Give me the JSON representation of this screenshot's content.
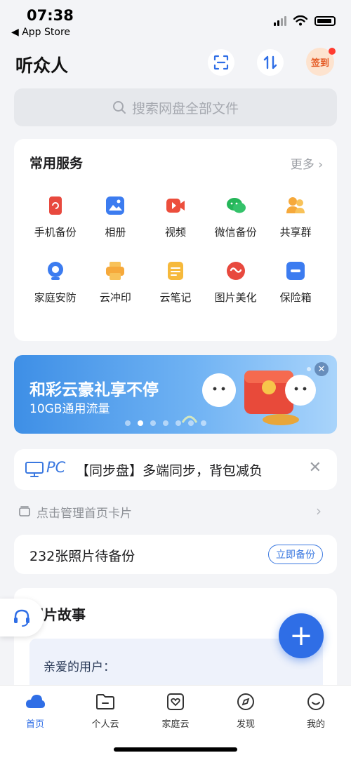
{
  "status_bar": {
    "time": "07:38",
    "back_label": "◀ App Store"
  },
  "header": {
    "username": "听众人",
    "checkin_label": "签到"
  },
  "search": {
    "placeholder": "搜索网盘全部文件"
  },
  "services": {
    "title": "常用服务",
    "more": "更多",
    "items": [
      {
        "label": "手机备份",
        "icon": "phone-backup-icon",
        "color": "#e8493e"
      },
      {
        "label": "相册",
        "icon": "album-icon",
        "color": "#3c7cf0"
      },
      {
        "label": "视频",
        "icon": "video-icon",
        "color": "#ec4e3c"
      },
      {
        "label": "微信备份",
        "icon": "wechat-icon",
        "color": "#25b659"
      },
      {
        "label": "共享群",
        "icon": "share-group-icon",
        "color": "#f6a93b"
      },
      {
        "label": "家庭安防",
        "icon": "camera-icon",
        "color": "#3c7cf0"
      },
      {
        "label": "云冲印",
        "icon": "print-icon",
        "color": "#f6a93b"
      },
      {
        "label": "云笔记",
        "icon": "note-icon",
        "color": "#f6b93b"
      },
      {
        "label": "图片美化",
        "icon": "beautify-icon",
        "color": "#e8493e"
      },
      {
        "label": "保险箱",
        "icon": "safe-box-icon",
        "color": "#3c7cf0"
      }
    ]
  },
  "banner": {
    "title": "和彩云豪礼享不停",
    "subtitle": "10GB通用流量",
    "slide_count": 7,
    "active_slide": 2
  },
  "pc_card": {
    "tag": "PC",
    "text": "【同步盘】多端同步，背包减负"
  },
  "manage": {
    "label": "点击管理首页卡片"
  },
  "backup": {
    "text": "232张照片待备份",
    "button": "立即备份"
  },
  "story": {
    "title": "照片故事",
    "greeting": "亲爱的用户："
  },
  "tabbar": {
    "tabs": [
      {
        "label": "首页",
        "icon": "cloud-icon",
        "active": true
      },
      {
        "label": "个人云",
        "icon": "folder-icon",
        "active": false
      },
      {
        "label": "家庭云",
        "icon": "family-icon",
        "active": false
      },
      {
        "label": "发现",
        "icon": "compass-icon",
        "active": false
      },
      {
        "label": "我的",
        "icon": "smile-icon",
        "active": false
      }
    ]
  },
  "colors": {
    "accent": "#2f6ee6",
    "background": "#f3f4f7"
  }
}
